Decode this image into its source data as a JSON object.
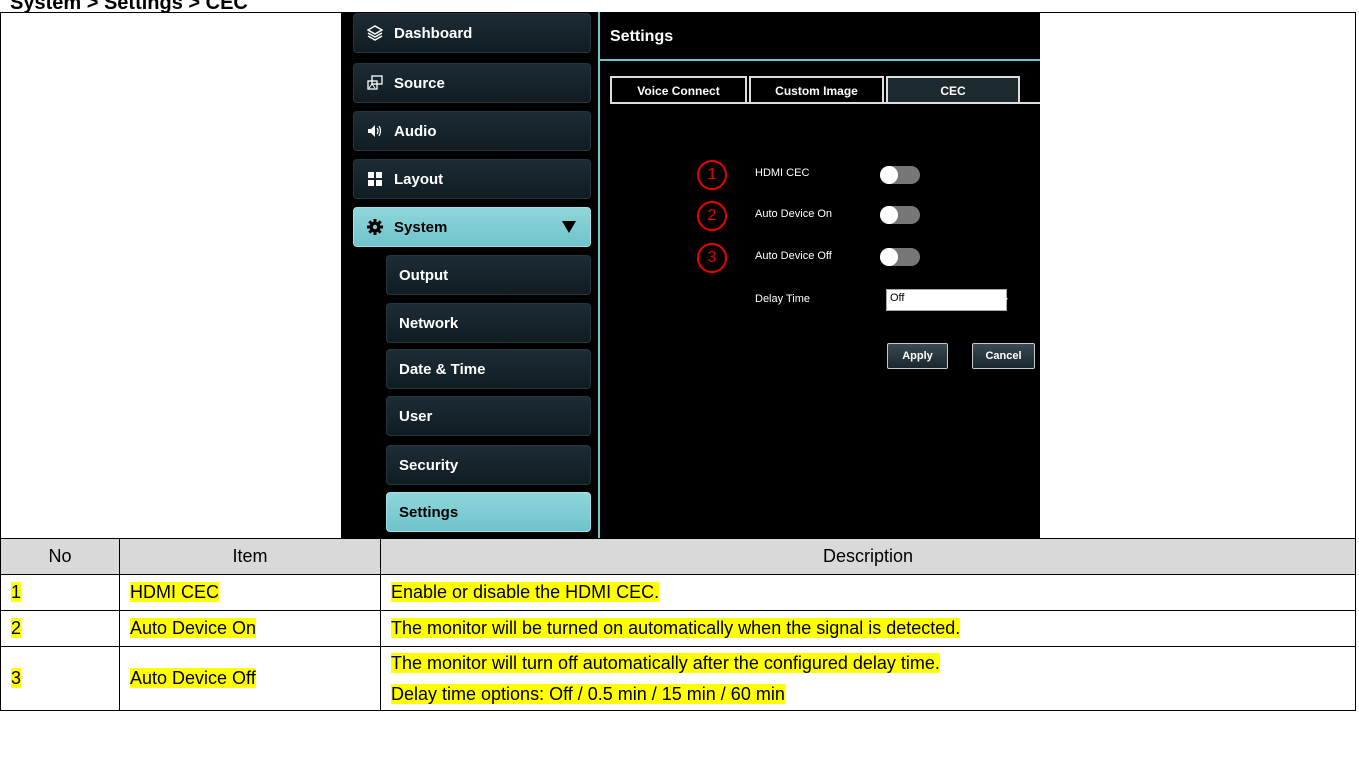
{
  "page_title": "System > Settings > CEC",
  "sidebar": {
    "items": [
      {
        "label": "Dashboard",
        "icon": "layers-icon"
      },
      {
        "label": "Source",
        "icon": "source-icon"
      },
      {
        "label": "Audio",
        "icon": "speaker-icon"
      },
      {
        "label": "Layout",
        "icon": "layout-icon"
      },
      {
        "label": "System",
        "icon": "gear-icon"
      }
    ],
    "sub_items": [
      "Output",
      "Network",
      "Date & Time",
      "User",
      "Security",
      "Settings"
    ]
  },
  "settings": {
    "title": "Settings",
    "tabs": [
      "Voice Connect",
      "Custom Image",
      "CEC"
    ],
    "rows": [
      {
        "num": "1",
        "label": "HDMI CEC"
      },
      {
        "num": "2",
        "label": "Auto Device On"
      },
      {
        "num": "3",
        "label": "Auto Device Off"
      }
    ],
    "delay_label": "Delay Time",
    "delay_value": "Off",
    "apply_label": "Apply",
    "cancel_label": "Cancel"
  },
  "table": {
    "headers": [
      "No",
      "Item",
      "Description"
    ],
    "rows": [
      {
        "no": "1",
        "item": "HDMI CEC",
        "desc": [
          "Enable or disable the HDMI CEC."
        ]
      },
      {
        "no": "2",
        "item": "Auto Device On",
        "desc": [
          "The monitor will be turned on automatically when the signal is detected."
        ]
      },
      {
        "no": "3",
        "item": "Auto Device Off",
        "desc": [
          "The monitor will turn off automatically after the configured delay time.",
          "Delay time options: Off / 0.5 min / 15 min / 60 min"
        ]
      }
    ]
  },
  "colors": {
    "accent": "#6fc4cb",
    "highlight": "#ffff00",
    "marker": "#e00000"
  }
}
